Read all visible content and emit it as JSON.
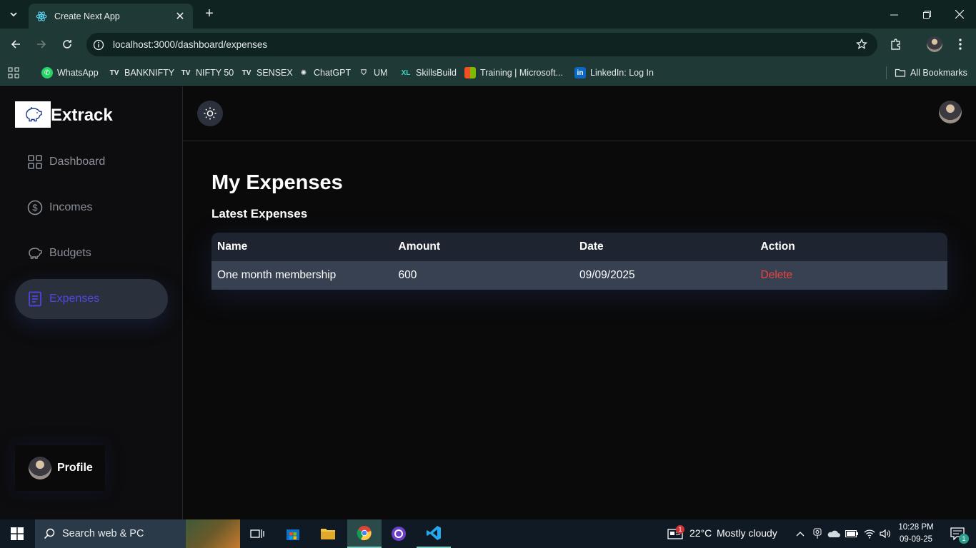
{
  "browser": {
    "tab_title": "Create Next App",
    "url": "localhost:3000/dashboard/expenses",
    "bookmarks": [
      {
        "label": "WhatsApp",
        "icon": "whatsapp-icon",
        "color": "#25d366"
      },
      {
        "label": "BANKNIFTY",
        "icon": "tradingview-icon",
        "color": "#e8eaed"
      },
      {
        "label": "NIFTY 50",
        "icon": "tradingview-icon",
        "color": "#e8eaed"
      },
      {
        "label": "SENSEX",
        "icon": "tradingview-icon",
        "color": "#e8eaed"
      },
      {
        "label": "ChatGPT",
        "icon": "chatgpt-icon",
        "color": "#e8eaed"
      },
      {
        "label": "UM",
        "icon": "shield-icon",
        "color": "#e8eaed"
      },
      {
        "label": "SkillsBuild",
        "icon": "skillsbuild-icon",
        "color": "#3ad6c4"
      },
      {
        "label": "Training | Microsoft...",
        "icon": "microsoft-icon",
        "color": "#f25022"
      },
      {
        "label": "LinkedIn: Log In",
        "icon": "linkedin-icon",
        "color": "#0a66c2"
      }
    ],
    "all_bookmarks": "All Bookmarks"
  },
  "app": {
    "brand": "Extrack",
    "nav": [
      {
        "label": "Dashboard",
        "icon": "grid-icon"
      },
      {
        "label": "Incomes",
        "icon": "dollar-circle-icon"
      },
      {
        "label": "Budgets",
        "icon": "piggy-bank-icon"
      },
      {
        "label": "Expenses",
        "icon": "receipt-icon",
        "active": true
      }
    ],
    "profile_label": "Profile",
    "page_title": "My Expenses",
    "section_title": "Latest Expenses",
    "table": {
      "headers": [
        "Name",
        "Amount",
        "Date",
        "Action"
      ],
      "rows": [
        {
          "name": "One month membership",
          "amount": "600",
          "date": "09/09/2025",
          "action": "Delete"
        }
      ]
    },
    "accent_color": "#4f46e5",
    "danger_color": "#ef4444"
  },
  "taskbar": {
    "search_placeholder": "Search web & PC",
    "weather_temp": "22°C",
    "weather_desc": "Mostly cloudy",
    "weather_badge": "1",
    "time": "10:28 PM",
    "date": "09-09-25",
    "notification_count": "1"
  }
}
